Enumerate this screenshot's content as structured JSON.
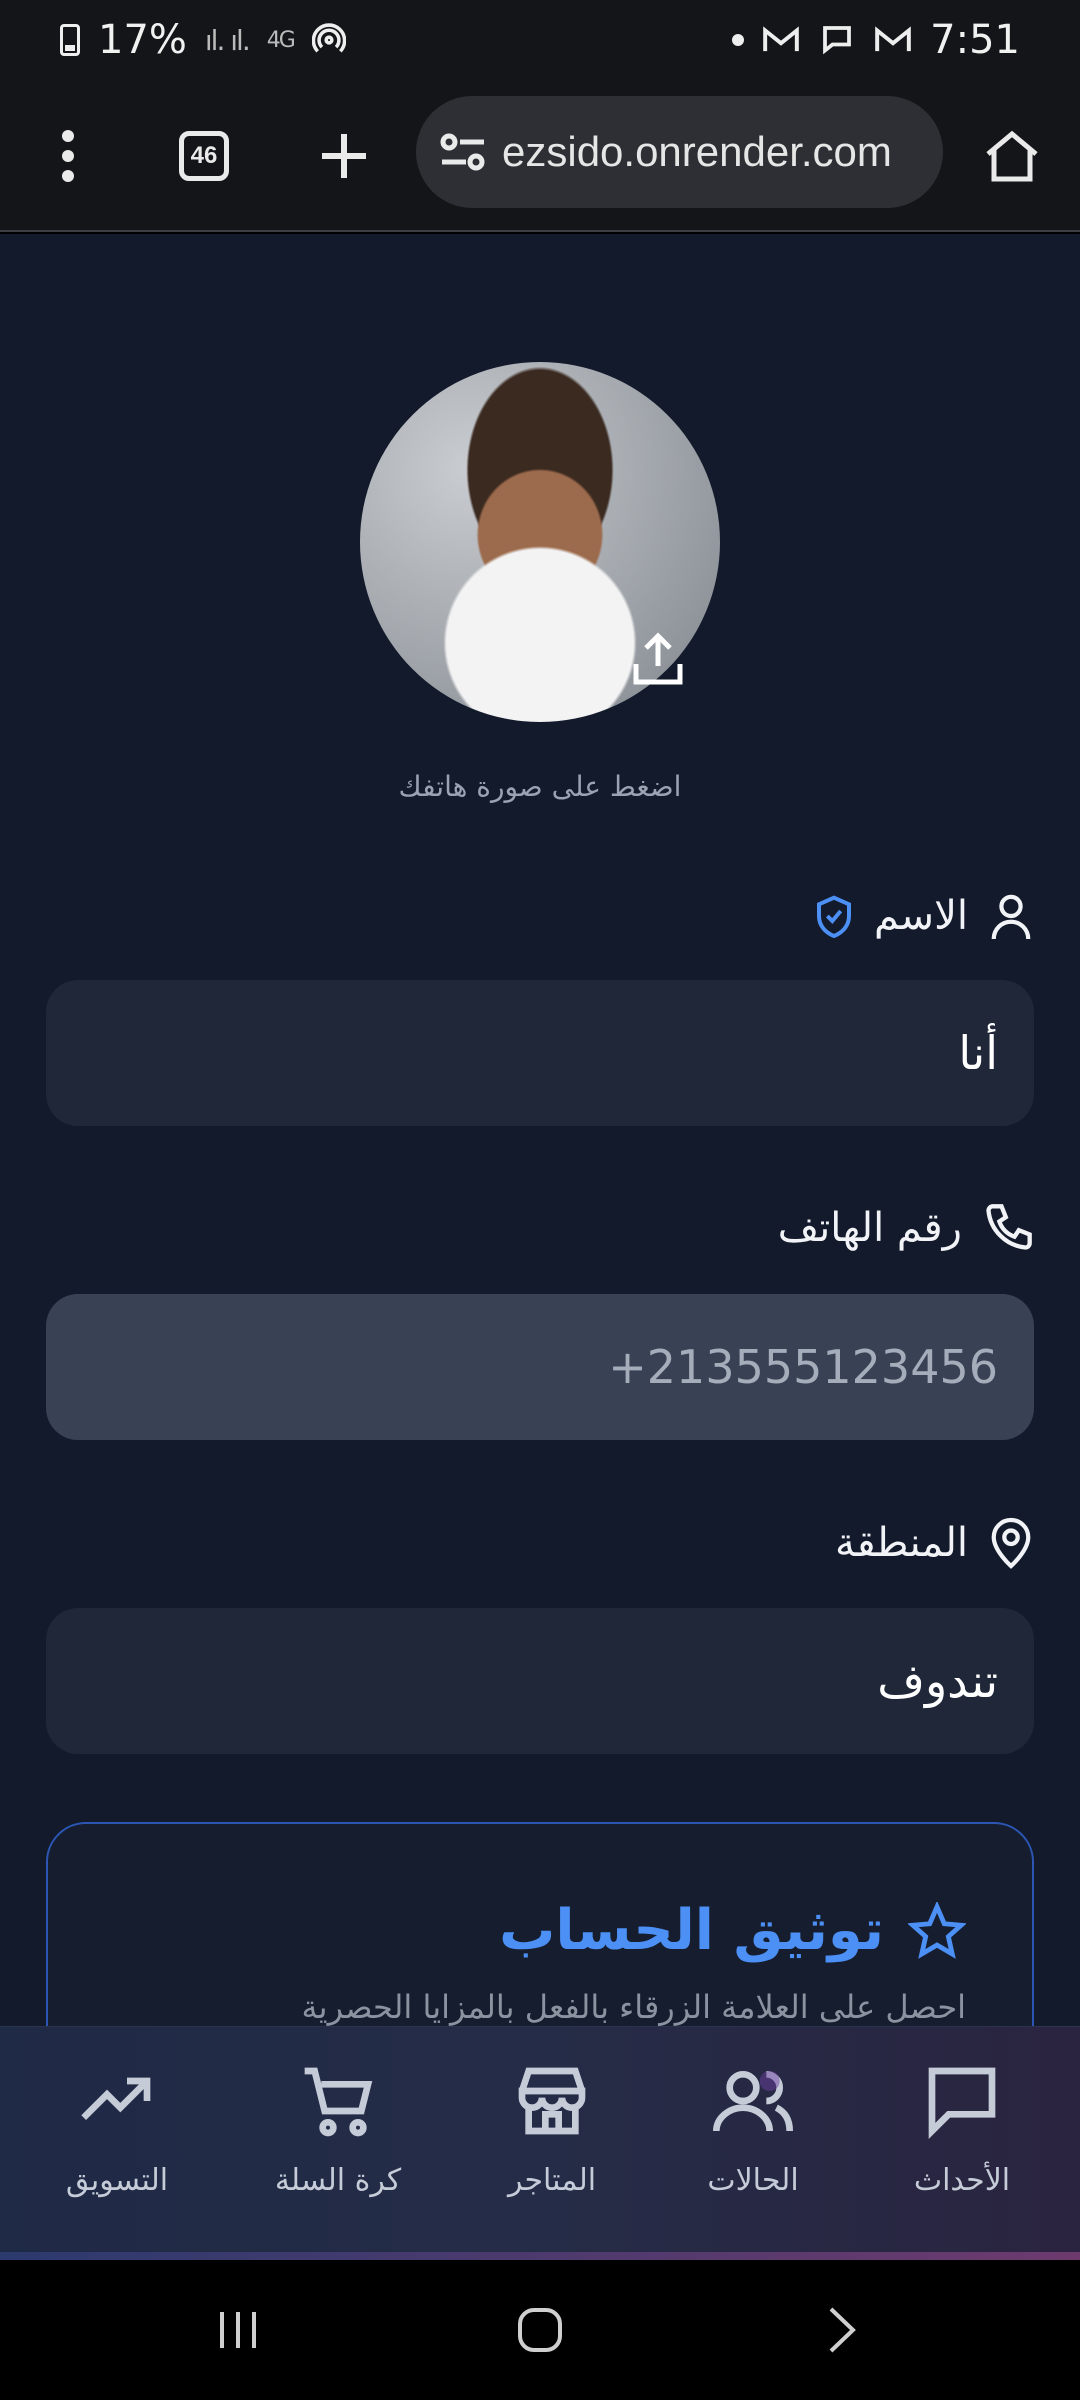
{
  "status": {
    "battery": "17%",
    "network": "4G",
    "time": "7:51"
  },
  "browser": {
    "tab_count": "46",
    "url": "ezsido.onrender.com"
  },
  "profile": {
    "avatar_hint": "اضغط على صورة هاتفك"
  },
  "form": {
    "name_label": "الاسم",
    "name_value": "أنا",
    "phone_label": "رقم الهاتف",
    "phone_value": "+213555123456",
    "region_label": "المنطقة",
    "region_value": "تندوف"
  },
  "verify": {
    "title": "توثيق الحساب",
    "subtitle": "احصل على العلامة الزرقاء بالفعل بالمزايا الحصرية"
  },
  "nav": {
    "items": [
      {
        "label": "التسويق",
        "icon": "trending-icon"
      },
      {
        "label": "كرة السلة",
        "icon": "cart-icon"
      },
      {
        "label": "المتاجر",
        "icon": "store-icon"
      },
      {
        "label": "الحالات",
        "icon": "users-icon"
      },
      {
        "label": "الأحداث",
        "icon": "chat-icon"
      }
    ]
  },
  "colors": {
    "accent": "#4c8ff5",
    "background": "#121a2b",
    "field": "#1f2738"
  }
}
